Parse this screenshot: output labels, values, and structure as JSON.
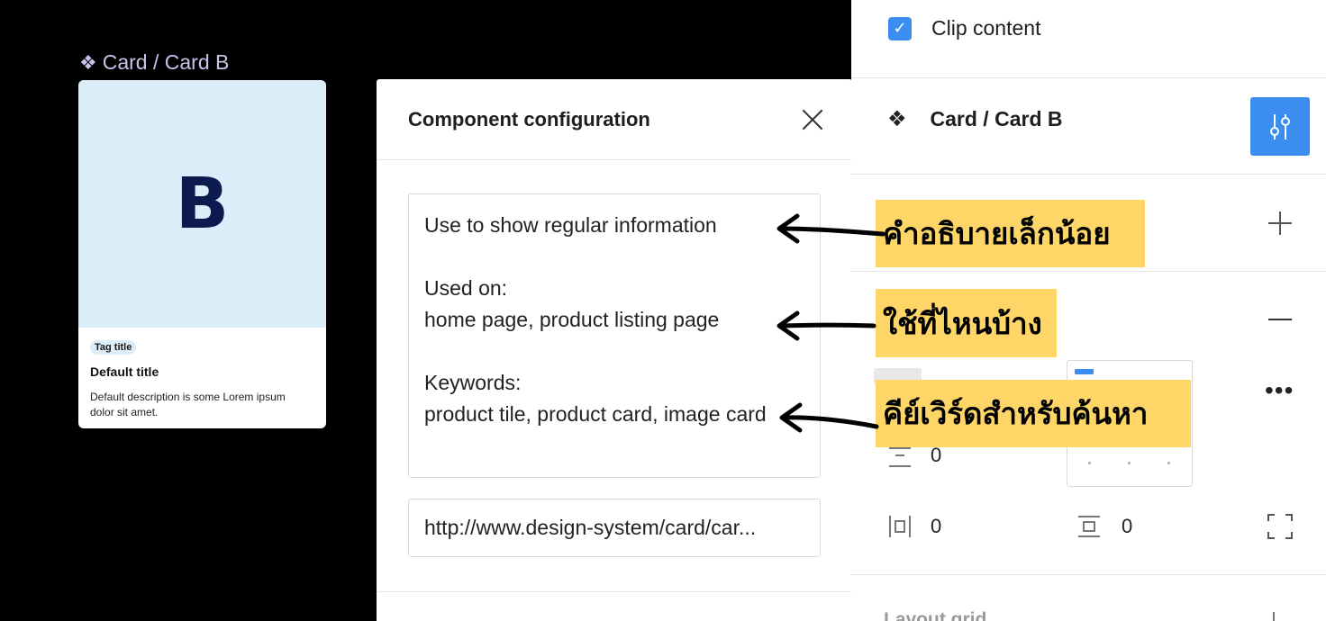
{
  "canvas": {
    "frame_label": "Card / Card B",
    "card": {
      "letter": "B",
      "tag": "Tag title",
      "title": "Default title",
      "description": "Default description is some Lorem ipsum dolor sit amet."
    }
  },
  "dialog": {
    "title": "Component configuration",
    "description_lines": [
      "Use to show regular information",
      "",
      "Used on:",
      "home page, product listing page",
      "",
      "Keywords:",
      "product tile, product card, image card"
    ],
    "link_value": "http://www.design-system/card/car..."
  },
  "panel": {
    "clip_content_label": "Clip content",
    "clip_content_checked": true,
    "component_name": "Card / Card B",
    "values": {
      "spacing_vertical": "0",
      "padding_horizontal": "0",
      "padding_vertical": "0"
    },
    "layout_grid_label": "Layout grid"
  },
  "annotations": {
    "description_note": "คำอธิบายเล็กน้อย",
    "usage_note": "ใช้ที่ไหนบ้าง",
    "keywords_note": "คีย์เวิร์ดสำหรับค้นหา"
  },
  "colors": {
    "accent": "#3b8ef0",
    "annotation_bg": "#fdd667",
    "card_image_bg": "#dcedfa",
    "card_letter": "#0b1a4f",
    "frame_label": "#c9c2ea"
  },
  "icons": {
    "component": "component-icon",
    "close": "close-icon",
    "config": "sliders-icon"
  }
}
